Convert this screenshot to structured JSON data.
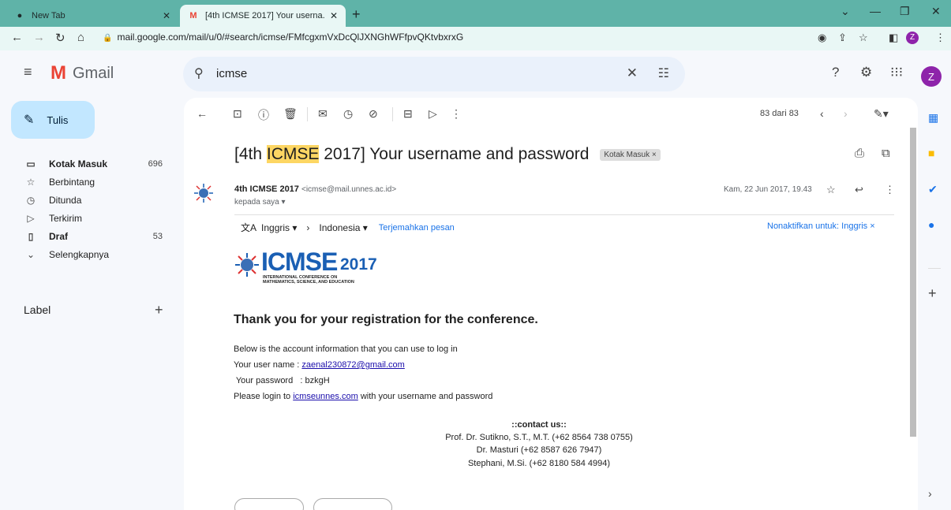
{
  "browser": {
    "tabs": [
      {
        "title": "New Tab",
        "active": false
      },
      {
        "title": "[4th ICMSE 2017] Your userna...",
        "active": true
      }
    ],
    "new_tab": "+",
    "url": "mail.google.com/mail/u/0/#search/icmse/FMfcgxmVxDcQlJXNGhWFfpvQKtvbxrxG",
    "profile_initial": "Z"
  },
  "gmail": {
    "app_name": "Gmail",
    "search_value": "icmse",
    "avatar_initial": "Z",
    "compose_label": "Tulis",
    "nav": [
      {
        "label": "Kotak Masuk",
        "count": "696",
        "bold": true,
        "icon": "inbox-icon"
      },
      {
        "label": "Berbintang",
        "count": "",
        "bold": false,
        "icon": "star-icon"
      },
      {
        "label": "Ditunda",
        "count": "",
        "bold": false,
        "icon": "clock-icon"
      },
      {
        "label": "Terkirim",
        "count": "",
        "bold": false,
        "icon": "send-icon"
      },
      {
        "label": "Draf",
        "count": "53",
        "bold": true,
        "icon": "draft-icon"
      },
      {
        "label": "Selengkapnya",
        "count": "",
        "bold": false,
        "icon": "chevron-down-icon"
      }
    ],
    "label_header": "Label"
  },
  "message": {
    "pager": "83 dari 83",
    "subject_prefix": "[4th ",
    "subject_highlight": "ICMSE",
    "subject_suffix": " 2017] Your username and password",
    "inbox_chip": "Kotak Masuk ×",
    "sender_name": "4th ICMSE 2017",
    "sender_email": "<icmse@mail.unnes.ac.id>",
    "to": "kepada saya ▾",
    "date": "Kam, 22 Jun 2017, 19.43",
    "translate_from": "Inggris ▾",
    "translate_to": "Indonesia ▾",
    "translate_link": "Terjemahkan pesan",
    "translate_off": "Nonaktifkan untuk: Inggris ×",
    "logo_text": "ICMSE",
    "logo_year": "2017",
    "logo_tag1": "INTERNATIONAL CONFERENCE ON",
    "logo_tag2": "MATHEMATICS, SCIENCE, AND EDUCATION",
    "heading": "Thank you for your registration for the conference.",
    "line1": "Below is the account information that you can use to log in",
    "line2_label": " Your user name : ",
    "line2_link": "zaenal230872@gmail.com",
    "line3": " Your password   : bzkgH",
    "line4_pre": "Please login to ",
    "line4_link": "icmseunnes.com",
    "line4_post": " with your username and password",
    "contact_title": "::contact us::",
    "contact_1": "Prof. Dr. Sutikno, S.T., M.T. (+62 8564 738 0755)",
    "contact_2": "Dr. Masturi (+62 8587 626 7947)",
    "contact_3": "Stephani, M.Si. (+62 8180 584 4994)"
  }
}
